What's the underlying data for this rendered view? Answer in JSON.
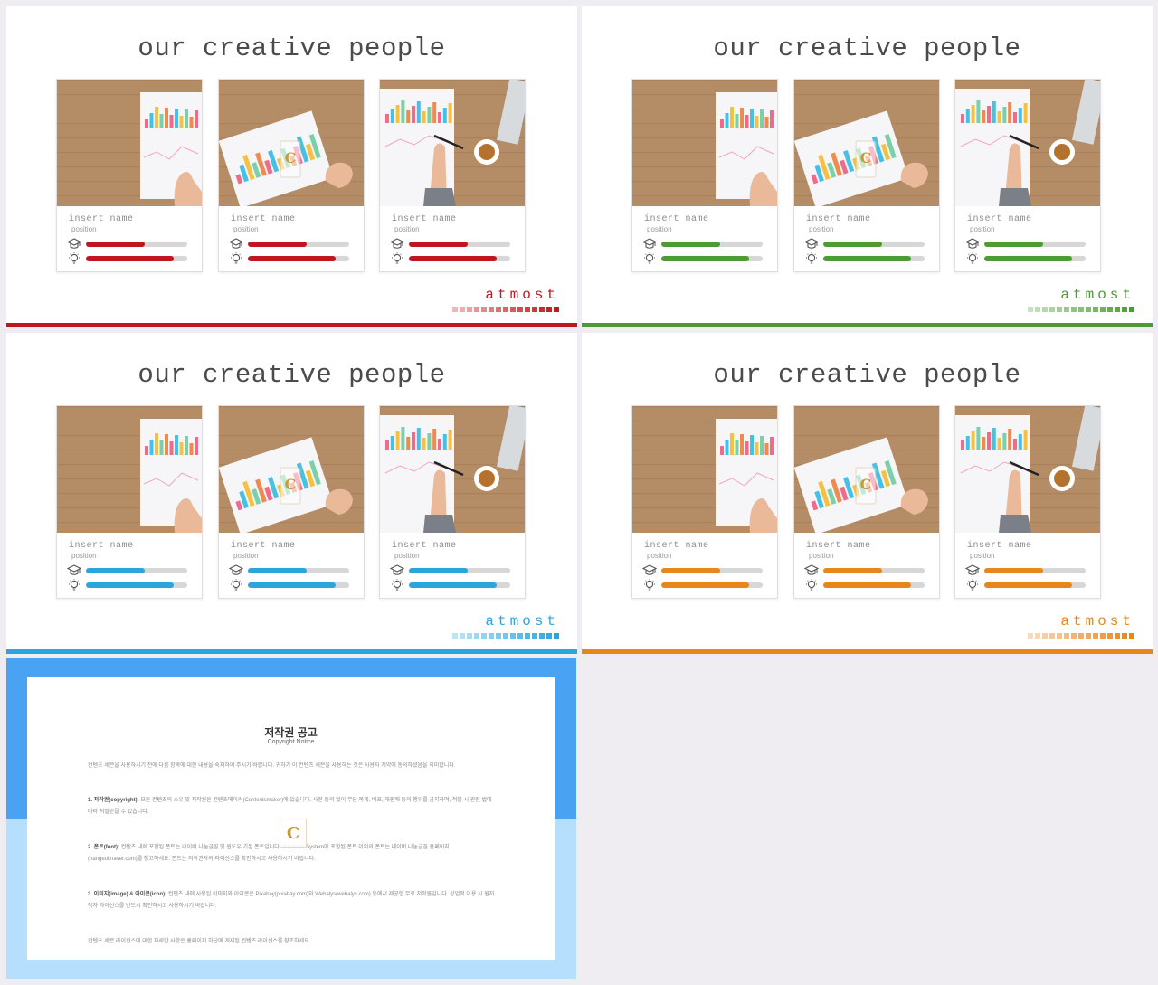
{
  "slides": [
    {
      "title": "our creative people",
      "brand": "atmost",
      "accent": "#c0161f",
      "members": [
        {
          "name": "insert name",
          "position": "position",
          "education": 0.58,
          "ideas": 0.87
        },
        {
          "name": "insert name",
          "position": "position",
          "education": 0.58,
          "ideas": 0.87
        },
        {
          "name": "insert name",
          "position": "position",
          "education": 0.58,
          "ideas": 0.87
        }
      ]
    },
    {
      "title": "our creative people",
      "brand": "atmost",
      "accent": "#4d9c33",
      "members": [
        {
          "name": "insert name",
          "position": "position",
          "education": 0.58,
          "ideas": 0.87
        },
        {
          "name": "insert name",
          "position": "position",
          "education": 0.58,
          "ideas": 0.87
        },
        {
          "name": "insert name",
          "position": "position",
          "education": 0.58,
          "ideas": 0.87
        }
      ]
    },
    {
      "title": "our creative people",
      "brand": "atmost",
      "accent": "#2aa6dc",
      "members": [
        {
          "name": "insert name",
          "position": "position",
          "education": 0.58,
          "ideas": 0.87
        },
        {
          "name": "insert name",
          "position": "position",
          "education": 0.58,
          "ideas": 0.87
        },
        {
          "name": "insert name",
          "position": "position",
          "education": 0.58,
          "ideas": 0.87
        }
      ]
    },
    {
      "title": "our creative people",
      "brand": "atmost",
      "accent": "#e8861c",
      "members": [
        {
          "name": "insert name",
          "position": "position",
          "education": 0.58,
          "ideas": 0.87
        },
        {
          "name": "insert name",
          "position": "position",
          "education": 0.58,
          "ideas": 0.87
        },
        {
          "name": "insert name",
          "position": "position",
          "education": 0.58,
          "ideas": 0.87
        }
      ]
    }
  ],
  "icons": [
    "graduation-cap-icon",
    "lightbulb-icon"
  ],
  "copyright": {
    "title": "저작권 공고",
    "subtitle": "Copyright Notice",
    "logo_letter": "C",
    "intro": "컨텐츠 세븐을 사용하시기 전에 다음 항목에 대한 내용을 숙지하여 주시기 바랍니다. 귀하가 이 컨텐츠 세븐을 사용하는 것은 사용자 계약에 동의하셨음을 의미합니다.",
    "sections": [
      {
        "head": "1. 저작권(copyright): ",
        "text": "모든 컨텐츠의 소유 및 저작권은 컨텐츠메이커(Contentsmaker)에 있습니다. 사전 동의 없이 무단 복제, 배포, 재판매 등의 행위를 금지하며, 적발 시 관련 법에 따라 처벌받을 수 있습니다."
      },
      {
        "head": "2. 폰트(font): ",
        "text": "컨텐츠 내에 포함된 폰트는 네이버 나눔글꼴 및 윈도우 기본 폰트입니다. Windows System에 포함된 폰트 이외의 폰트는 네이버 나눔글꼴 홈페이지(hangeul.naver.com)를 참고하세요. 폰트는 저작권자의 라이선스를 확인하시고 사용하시기 바랍니다."
      },
      {
        "head": "3. 이미지(image) & 아이콘(icon): ",
        "text": "컨텐츠 내에 사용된 이미지와 아이콘은 Pixabay(pixabay.com)와 Webalys(webalys.com) 등에서 제공한 무료 저작물입니다. 상업적 이용 시 원저작자 라이선스를 반드시 확인하시고 사용하시기 바랍니다."
      }
    ],
    "footer": "컨텐츠 세븐 라이선스에 대한 자세한 사항은 홈페이지 하단에 게재된 컨텐츠 라이선스를 참조하세요."
  }
}
